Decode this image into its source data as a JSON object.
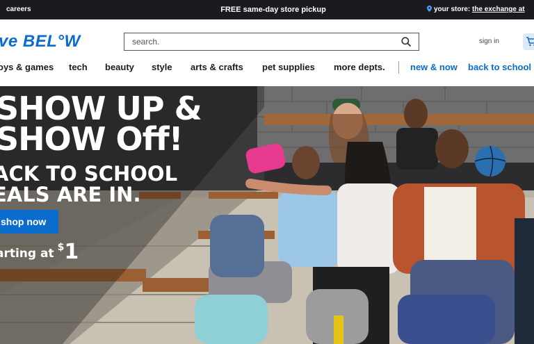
{
  "topbar": {
    "careers": "careers",
    "promo": "FREE same-day store pickup",
    "store_prefix": "your store:",
    "store_name": "the exchange at"
  },
  "header": {
    "logo": "ve BEL°W",
    "search_placeholder": "search.",
    "signin": "sign in",
    "cart_icon": "cart-icon"
  },
  "nav": {
    "items": [
      "oys & games",
      "tech",
      "beauty",
      "style",
      "arts & crafts",
      "pet supplies",
      "more depts."
    ],
    "featured": [
      "new & now",
      "back to school"
    ]
  },
  "hero": {
    "headline_1": "SHOW UP &",
    "headline_2": "SHOW Off!",
    "sub_1": "ACK TO SCHOOL",
    "sub_2": "EALS ARE IN.",
    "button": "shop now",
    "starting_text": "arting at",
    "dollar": "$",
    "price": "1"
  },
  "colors": {
    "brand_blue": "#0a6ccc",
    "topbar": "#1b1b1f",
    "text_dark": "#1b1b1f"
  }
}
